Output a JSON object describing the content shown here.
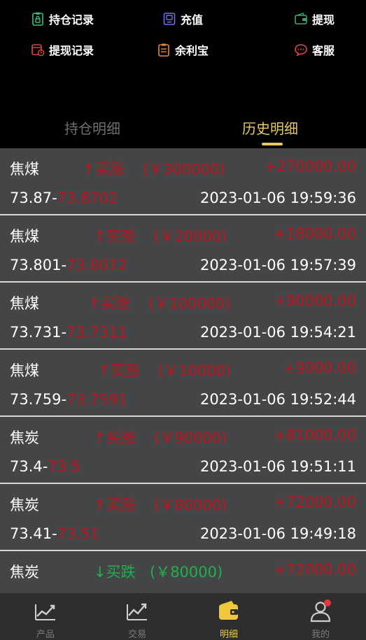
{
  "quick_actions": [
    {
      "label": "持仓记录",
      "icon": "clipboard-lock-icon",
      "color": "#39c07f"
    },
    {
      "label": "充值",
      "icon": "device-icon",
      "color": "#6e6cf0"
    },
    {
      "label": "提现",
      "icon": "wallet-icon",
      "color": "#3aa56a"
    },
    {
      "label": "提现记录",
      "icon": "calendar-clock-icon",
      "color": "#e0463c"
    },
    {
      "label": "余利宝",
      "icon": "clipboard-icon",
      "color": "#e88a3a"
    },
    {
      "label": "客服",
      "icon": "chat-bubble-icon",
      "color": "#e64545"
    }
  ],
  "tabs": {
    "positions": "持仓明细",
    "history": "历史明细"
  },
  "records": [
    {
      "name": "焦煤",
      "direction": "↑买涨",
      "stake": "(￥300000)",
      "profit": "+270000.00",
      "open_price": "73.87-",
      "close_price": "73.8702",
      "time": "2023-01-06 19:59:36",
      "dir_type": "up"
    },
    {
      "name": "焦煤",
      "direction": "↑买涨",
      "stake": "(￥20000)",
      "profit": "+18000.00",
      "open_price": "73.801-",
      "close_price": "73.8012",
      "time": "2023-01-06 19:57:39",
      "dir_type": "up"
    },
    {
      "name": "焦煤",
      "direction": "↑买涨",
      "stake": "(￥100000)",
      "profit": "+90000.00",
      "open_price": "73.731-",
      "close_price": "73.7311",
      "time": "2023-01-06 19:54:21",
      "dir_type": "up"
    },
    {
      "name": "焦煤",
      "direction": "↑买涨",
      "stake": "(￥10000)",
      "profit": "+9000.00",
      "open_price": "73.759-",
      "close_price": "73.7591",
      "time": "2023-01-06 19:52:44",
      "dir_type": "up"
    },
    {
      "name": "焦炭",
      "direction": "↑买涨",
      "stake": "(￥90000)",
      "profit": "+81000.00",
      "open_price": "73.4-",
      "close_price": "73.5",
      "time": "2023-01-06 19:51:11",
      "dir_type": "up"
    },
    {
      "name": "焦炭",
      "direction": "↑买涨",
      "stake": "(￥80000)",
      "profit": "+72000.00",
      "open_price": "73.41-",
      "close_price": "73.51",
      "time": "2023-01-06 19:49:18",
      "dir_type": "up"
    },
    {
      "name": "焦炭",
      "direction": "↓买跌",
      "stake": "(￥80000)",
      "profit": "+72000.00",
      "open_price": "",
      "close_price": "",
      "time": "",
      "dir_type": "down"
    }
  ],
  "nav": [
    {
      "label": "产品",
      "icon": "line-chart-icon"
    },
    {
      "label": "交易",
      "icon": "trend-chart-icon"
    },
    {
      "label": "明细",
      "icon": "wallet-icon"
    },
    {
      "label": "我的",
      "icon": "user-icon"
    }
  ]
}
